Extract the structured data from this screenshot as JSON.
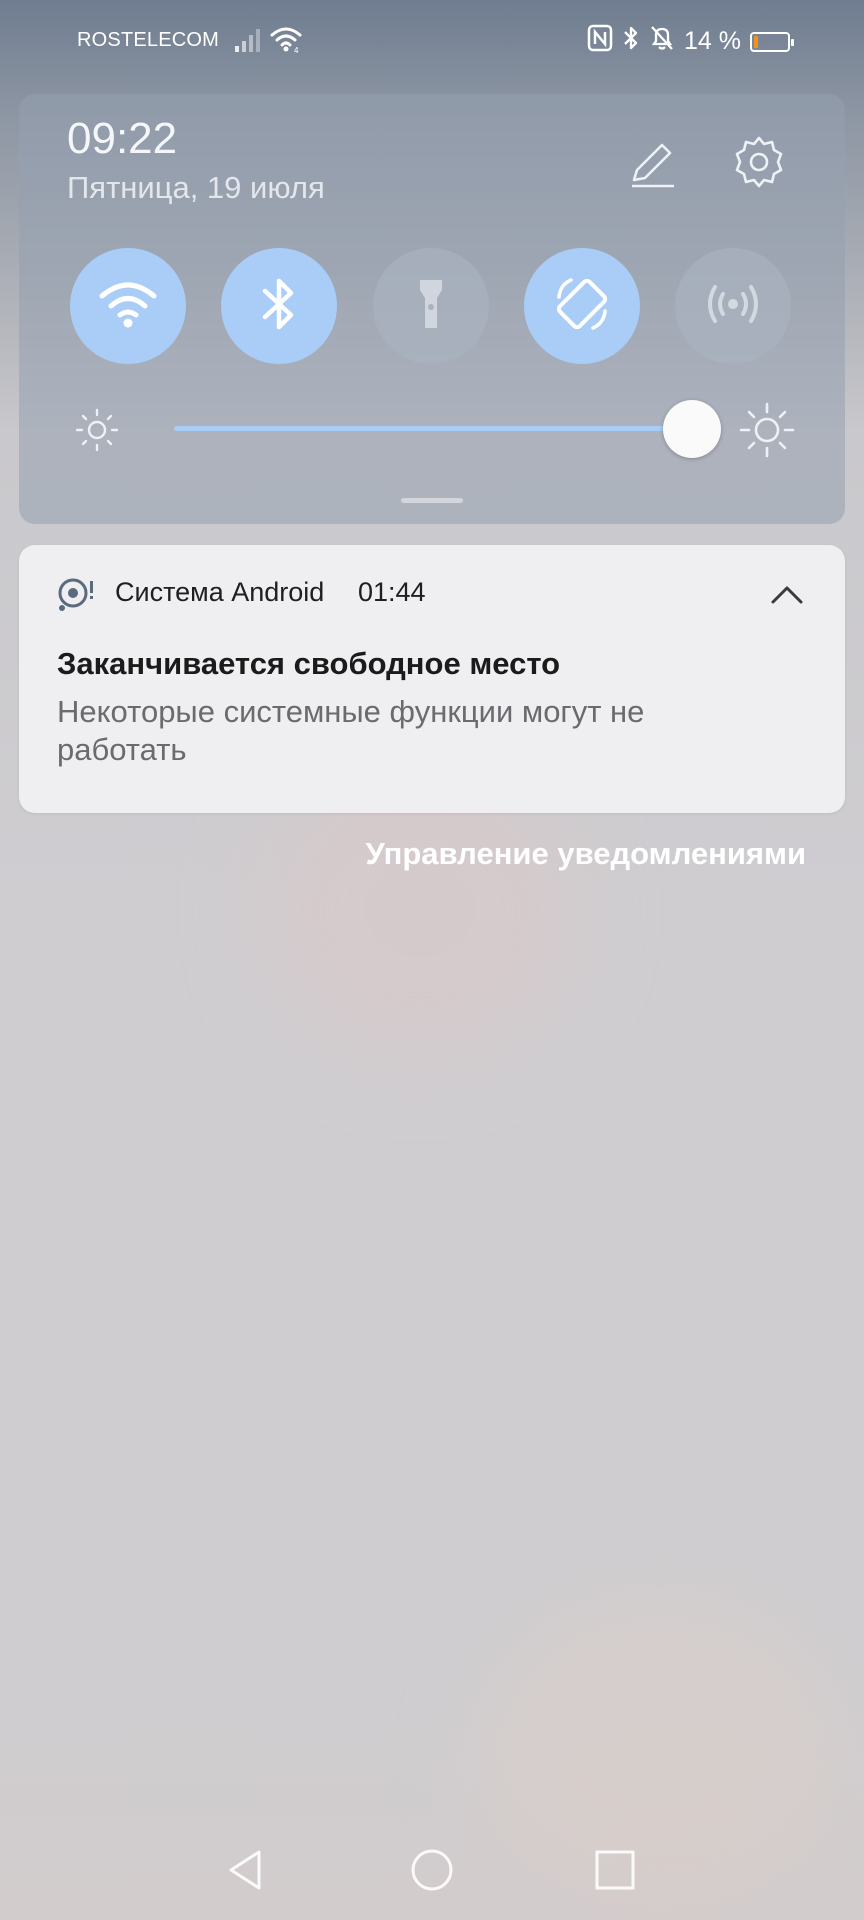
{
  "status_bar": {
    "carrier": "ROSTELECOM",
    "battery_text": "14 %",
    "battery_level": 0.14,
    "battery_color": "#f29318"
  },
  "quick_settings": {
    "time": "09:22",
    "date": "Пятница, 19 июля",
    "tiles": [
      {
        "icon": "wifi-icon",
        "state": "on"
      },
      {
        "icon": "bluetooth-icon",
        "state": "on"
      },
      {
        "icon": "flashlight-icon",
        "state": "off"
      },
      {
        "icon": "auto-rotate-icon",
        "state": "on"
      },
      {
        "icon": "hotspot-icon",
        "state": "off"
      }
    ],
    "brightness_level": 0.92,
    "accent_color": "#a9cdf6"
  },
  "notification": {
    "app_name": "Система Android",
    "time": "01:44",
    "title": "Заканчивается свободное место",
    "body": "Некоторые системные функции могут не работать"
  },
  "manage_notifications_label": "Управление уведомлениями",
  "nav_bar": {
    "buttons": [
      "back-icon",
      "home-icon",
      "recents-icon"
    ]
  }
}
